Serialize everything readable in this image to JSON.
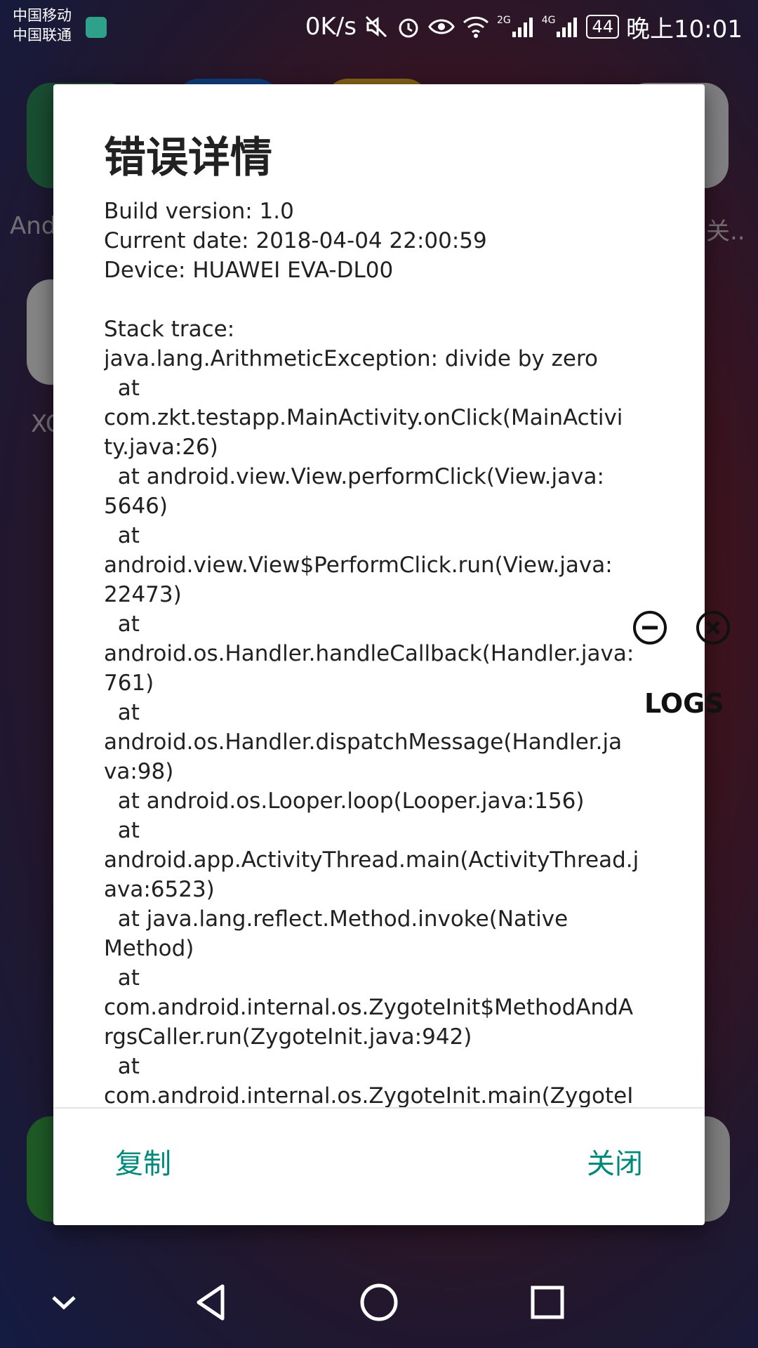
{
  "status_bar": {
    "carrier_1": "中国移动",
    "carrier_2": "中国联通",
    "net_speed": "0K/s",
    "signal_2g": "2G",
    "signal_4g": "4G",
    "battery": "44",
    "time": "晚上10:01"
  },
  "backdrop": {
    "label_left_1": "And",
    "label_left_2": "XC",
    "label_right_1": "关.."
  },
  "dialog": {
    "title": "错误详情",
    "message": "Build version: 1.0\nCurrent date: 2018-04-04 22:00:59\nDevice: HUAWEI EVA-DL00\n\nStack trace:\njava.lang.ArithmeticException: divide by zero\n  at\ncom.zkt.testapp.MainActivity.onClick(MainActivi\nty.java:26)\n  at android.view.View.performClick(View.java:\n5646)\n  at\nandroid.view.View$PerformClick.run(View.java:\n22473)\n  at\nandroid.os.Handler.handleCallback(Handler.java:\n761)\n  at\nandroid.os.Handler.dispatchMessage(Handler.ja\nva:98)\n  at android.os.Looper.loop(Looper.java:156)\n  at\nandroid.app.ActivityThread.main(ActivityThread.j\nava:6523)\n  at java.lang.reflect.Method.invoke(Native\nMethod)\n  at\ncom.android.internal.os.ZygoteInit$MethodAndA\nrgsCaller.run(ZygoteInit.java:942)\n  at\ncom.android.internal.os.ZygoteInit.main(ZygoteI",
    "copy_label": "复制",
    "close_label": "关闭"
  },
  "overlay": {
    "logs_label": "LOGS",
    "minimize_icon": "minus-circle-icon",
    "close_icon": "x-circle-icon"
  },
  "colors": {
    "accent": "#00897b",
    "dialog_bg": "#ffffff",
    "text": "#212121"
  }
}
